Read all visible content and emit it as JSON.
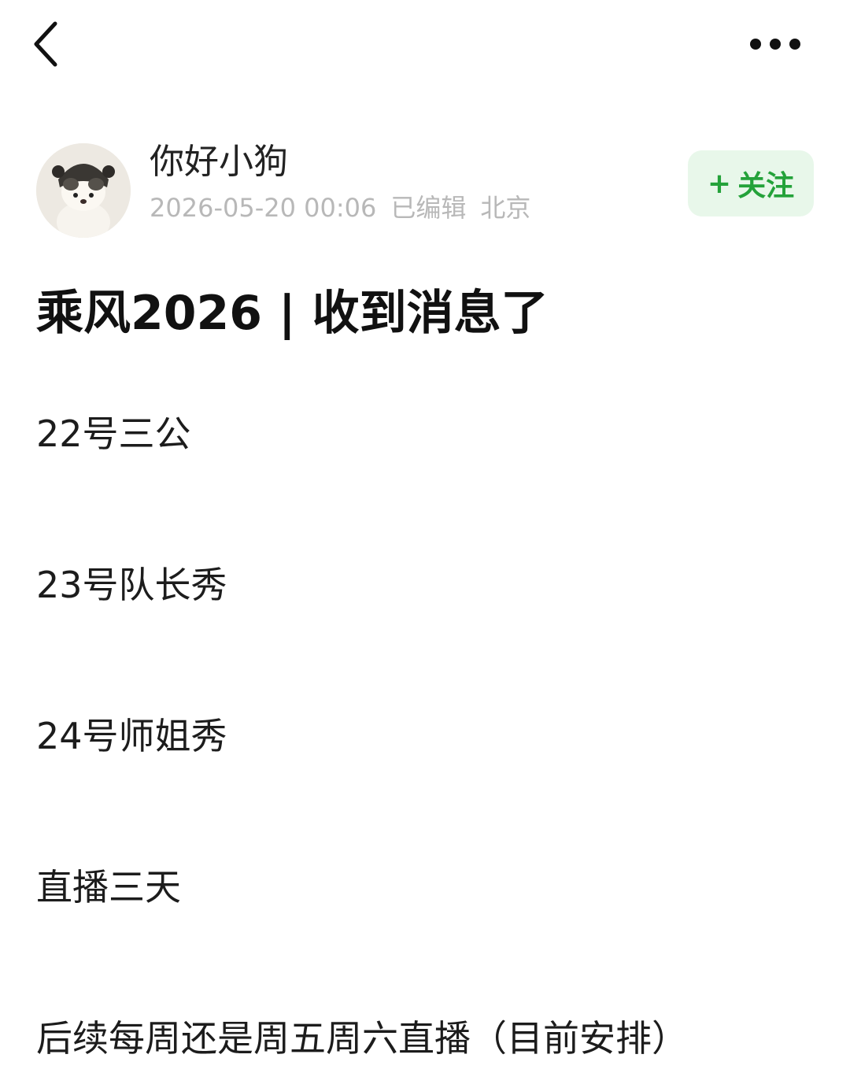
{
  "topbar": {
    "back_icon": "chevron-left-icon",
    "more_icon": "ellipsis-icon"
  },
  "author": {
    "name": "你好小狗",
    "timestamp": "2026-05-20 00:06",
    "edited": "已编辑",
    "location": "北京",
    "follow_plus": "+",
    "follow_label": "关注",
    "follow_color": "#24a23a",
    "follow_bg": "#e8f7ea"
  },
  "post": {
    "title": "乘风2026 | 收到消息了",
    "lines": [
      "22号三公",
      "23号队长秀",
      "24号师姐秀",
      "直播三天",
      "后续每周还是周五周六直播（目前安排）"
    ]
  }
}
